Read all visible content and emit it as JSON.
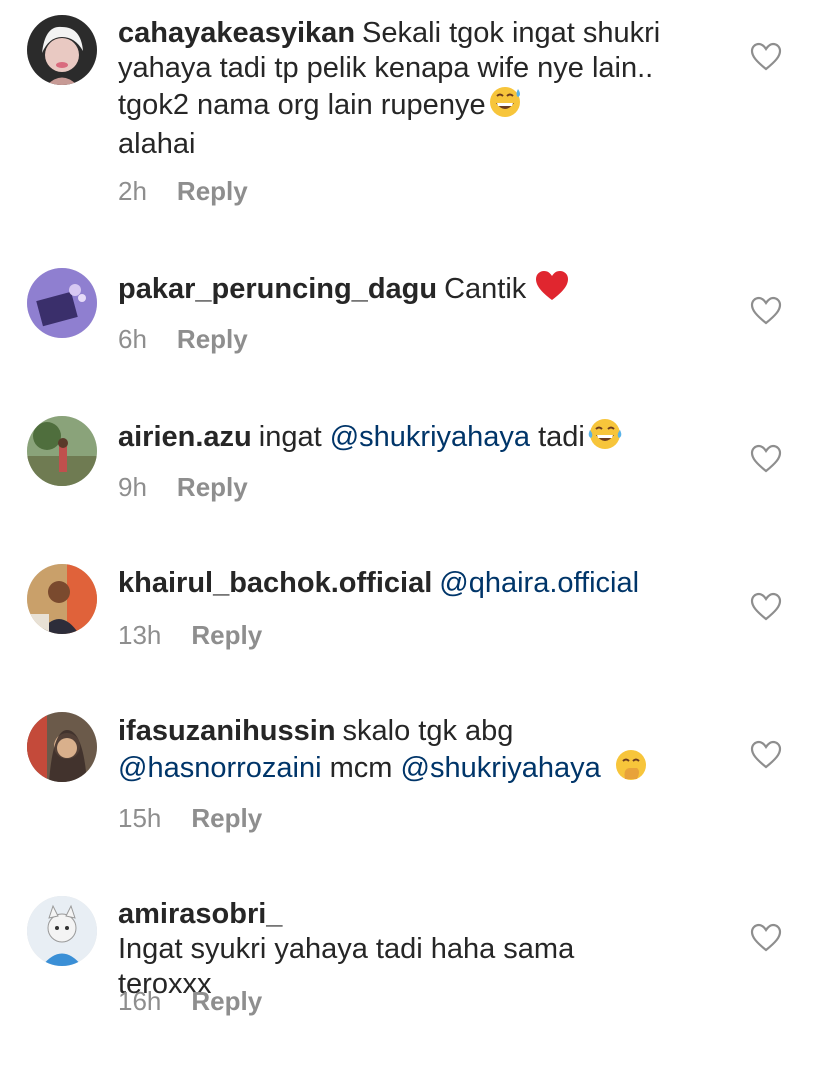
{
  "comments": [
    {
      "username": "cahayakeasyikan",
      "text": "Sekali tgok ingat shukri yahaya tadi tp pelik kenapa wife nye lain.. tgok2 nama org lain rupenye",
      "text_after": "alahai",
      "emoji": "grinning-sweat-emoji",
      "time": "2h",
      "reply": "Reply"
    },
    {
      "username": "pakar_peruncing_dagu",
      "text": "Cantik",
      "emoji": "red-heart-emoji",
      "time": "6h",
      "reply": "Reply"
    },
    {
      "username": "airien.azu",
      "text": "ingat",
      "mention": "@shukriyahaya",
      "text_after": "tadi",
      "emoji": "tears-of-joy-emoji",
      "time": "9h",
      "reply": "Reply"
    },
    {
      "username": "khairul_bachok.official",
      "mention": "@qhaira.official",
      "time": "13h",
      "reply": "Reply"
    },
    {
      "username": "ifasuzanihussin",
      "text": "skalo tgk abg",
      "mention": "@hasnorrozaini",
      "text_mid": "mcm",
      "mention2": "@shukriyahaya",
      "emoji": "hand-over-mouth-emoji",
      "time": "15h",
      "reply": "Reply"
    },
    {
      "username": "amirasobri_",
      "text": "Ingat syukri yahaya tadi haha sama teroxxx",
      "time": "16h",
      "reply": "Reply"
    }
  ],
  "colors": {
    "text": "#262626",
    "meta": "#8e8e8e",
    "mention": "#003569",
    "heart_outline": "#8e8e8e"
  },
  "icons": {
    "like": "heart-outline-icon"
  }
}
